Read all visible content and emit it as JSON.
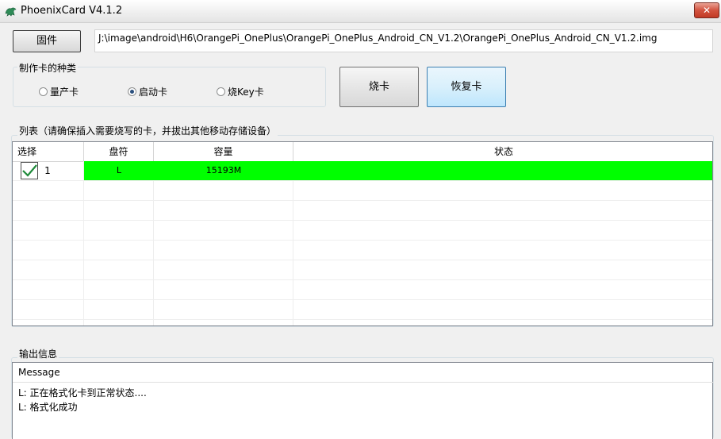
{
  "window": {
    "title": "PhoenixCard V4.1.2",
    "close_label": "✕"
  },
  "firmware": {
    "button_label": "固件",
    "path": "J:\\image\\android\\H6\\OrangePi_OnePlus\\OrangePi_OnePlus_Android_CN_V1.2\\OrangePi_OnePlus_Android_CN_V1.2.img"
  },
  "card_type": {
    "label": "制作卡的种类",
    "options": [
      {
        "label": "量产卡",
        "checked": false
      },
      {
        "label": "启动卡",
        "checked": true
      },
      {
        "label": "烧Key卡",
        "checked": false
      }
    ]
  },
  "actions": {
    "burn_label": "烧卡",
    "restore_label": "恢复卡"
  },
  "list": {
    "label": "列表（请确保插入需要烧写的卡，并拔出其他移动存储设备）",
    "columns": [
      "选择",
      "盘符",
      "容量",
      "状态"
    ],
    "rows": [
      {
        "index": "1",
        "checked": true,
        "drive": "L",
        "capacity": "15193M",
        "status": ""
      }
    ]
  },
  "output": {
    "label": "输出信息",
    "header": "Message",
    "lines": [
      "L: 正在格式化卡到正常状态....",
      "L: 格式化成功"
    ]
  },
  "colors": {
    "row_highlight": "#00ff00",
    "selected_button": "#bee6fd"
  }
}
